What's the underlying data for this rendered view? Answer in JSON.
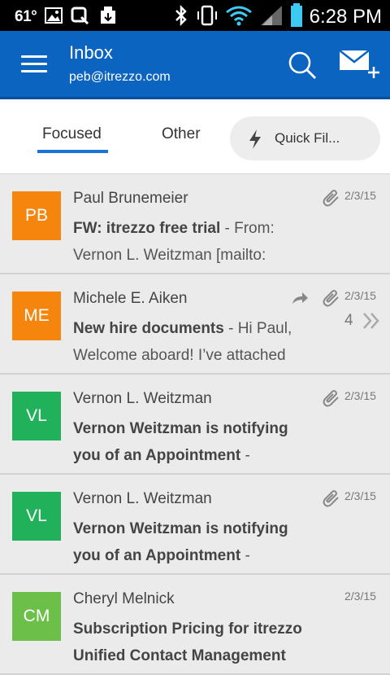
{
  "status_bar": {
    "temperature": "61°",
    "time": "6:28 PM"
  },
  "app_bar": {
    "title": "Inbox",
    "account": "peb@itrezzo.com"
  },
  "tabs": {
    "focused": "Focused",
    "other": "Other",
    "quick_filter": "Quick Fil..."
  },
  "colors": {
    "app_bar": "#0c64c1",
    "tab_underline": "#1a73d6",
    "avatar_orange": "#f5850c",
    "avatar_green": "#21b15a",
    "avatar_lime": "#6cc04a"
  },
  "messages": [
    {
      "initials": "PB",
      "avatar_color": "#f5850c",
      "sender": "Paul Brunemeier",
      "subject": "FW: itrezzo free trial",
      "snippet": " - From: Vernon L. Weitzman [mailto:",
      "date": "2/3/15",
      "has_attachment": true,
      "replied": false,
      "thread_count": ""
    },
    {
      "initials": "ME",
      "avatar_color": "#f5850c",
      "sender": "Michele E. Aiken",
      "subject": "New hire documents",
      "snippet": " - Hi Paul, Welcome aboard! I’ve attached",
      "date": "2/3/15",
      "has_attachment": true,
      "replied": true,
      "thread_count": "4"
    },
    {
      "initials": "VL",
      "avatar_color": "#21b15a",
      "sender": "Vernon L. Weitzman",
      "subject": "Vernon Weitzman is notifying you of an Appointment",
      "snippet": " -",
      "date": "2/3/15",
      "has_attachment": true,
      "replied": false,
      "thread_count": ""
    },
    {
      "initials": "VL",
      "avatar_color": "#21b15a",
      "sender": "Vernon L. Weitzman",
      "subject": "Vernon Weitzman is notifying you of an Appointment",
      "snippet": " -",
      "date": "2/3/15",
      "has_attachment": true,
      "replied": false,
      "thread_count": ""
    },
    {
      "initials": "CM",
      "avatar_color": "#6cc04a",
      "sender": "Cheryl Melnick",
      "subject": "Subscription Pricing for itrezzo Unified Contact Management",
      "snippet": "",
      "date": "2/3/15",
      "has_attachment": false,
      "replied": false,
      "thread_count": ""
    }
  ]
}
